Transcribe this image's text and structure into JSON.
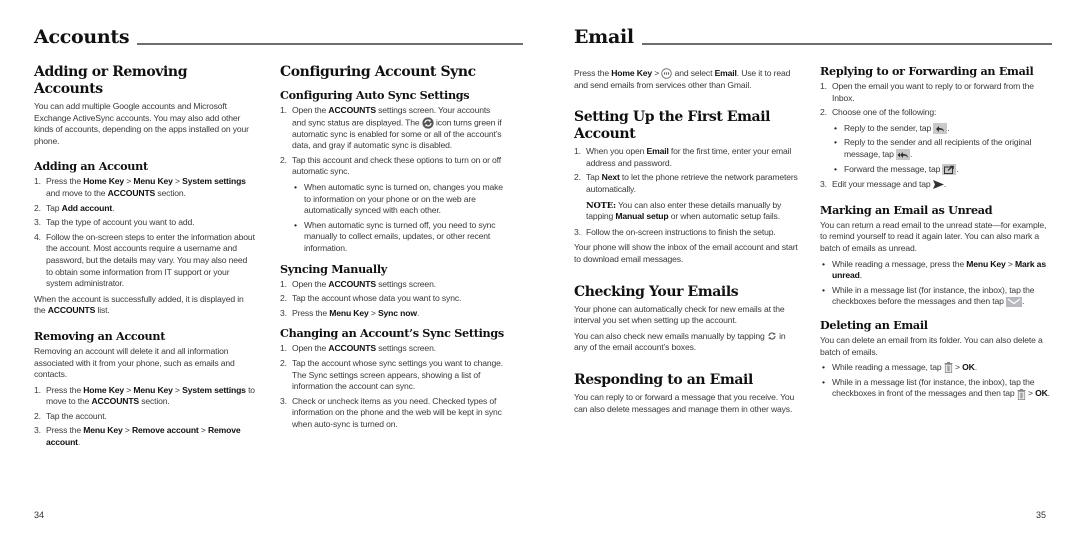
{
  "left_page": {
    "chapter_title": "Accounts",
    "page_number": "34",
    "adding_removing": {
      "title": "Adding or Removing Accounts",
      "intro": "You can add multiple Google accounts and Microsoft Exchange ActiveSync accounts. You may also add other kinds of accounts, depending on the apps installed on your phone.",
      "adding": {
        "title": "Adding an Account",
        "step1": {
          "a": "Press the ",
          "b": "Home Key",
          "c": " > ",
          "d": "Menu Key",
          "e": " > ",
          "f": "System settings",
          "g": " and move to the ",
          "h": "ACCOUNTS",
          "i": " section."
        },
        "step2": {
          "a": "Tap ",
          "b": "Add account",
          "c": "."
        },
        "step3": "Tap the type of account you want to add.",
        "step4": "Follow the on-screen steps to enter the information about the account. Most accounts require a username and password, but the details may vary. You may also need to obtain some information from IT support or your system administrator.",
        "after": {
          "a": "When the account is successfully added, it is displayed in the ",
          "b": "ACCOUNTS",
          "c": " list."
        }
      },
      "removing": {
        "title": "Removing an Account",
        "intro": "Removing an account will delete it and all information associated with it from your phone, such as emails and contacts.",
        "step1": {
          "a": "Press the ",
          "b": "Home Key",
          "c": " > ",
          "d": "Menu Key",
          "e": " > ",
          "f": "System settings",
          "g": " to move to the ",
          "h": "ACCOUNTS",
          "i": " section."
        },
        "step2": "Tap the account.",
        "step3": {
          "a": "Press the ",
          "b": "Menu Key",
          "c": " > ",
          "d": "Remove account",
          "e": " > ",
          "f": "Remove account",
          "g": "."
        }
      }
    },
    "configuring_sync": {
      "title": "Configuring Account Sync",
      "auto": {
        "title": "Configuring Auto Sync Settings",
        "step1": {
          "a": "Open the ",
          "b": "ACCOUNTS",
          "c": " settings screen. Your accounts and sync status are displayed. The ",
          "icon": "sync-status-icon",
          "d": " icon turns green if automatic sync is enabled for some or all of the account’s data, and gray if automatic sync is disabled."
        },
        "step2": "Tap this account and check these options to turn on or off automatic sync.",
        "bullets": [
          "When automatic sync is turned on, changes you make to information on your phone or on the web are automatically synced with each other.",
          "When automatic sync is turned off, you need to sync manually to collect emails, updates, or other recent information."
        ]
      },
      "manual": {
        "title": "Syncing Manually",
        "step1": {
          "a": "Open the ",
          "b": "ACCOUNTS",
          "c": " settings screen."
        },
        "step2": "Tap the account whose data you want to sync.",
        "step3": {
          "a": "Press the ",
          "b": "Menu Key",
          "c": " > ",
          "d": "Sync now",
          "e": "."
        }
      },
      "changing": {
        "title": "Changing an Account’s Sync Settings",
        "step1": {
          "a": "Open the ",
          "b": "ACCOUNTS",
          "c": " settings screen."
        },
        "step2": "Tap the account whose sync settings you want to change. The Sync settings screen appears, showing a list of information the account can sync.",
        "step3": "Check or uncheck items as you need. Checked types of information on the phone and the web will be kept in sync when auto-sync is turned on."
      }
    }
  },
  "right_page": {
    "chapter_title": "Email",
    "page_number": "35",
    "intro": {
      "a": "Press the ",
      "b": "Home Key",
      "c": " > ",
      "icon": "apps-icon",
      "d": " and select ",
      "e": "Email",
      "f": ". Use it to read and send emails from services other than Gmail."
    },
    "setup": {
      "title": "Setting Up the First Email Account",
      "step1": {
        "a": "When you open ",
        "b": "Email",
        "c": " for the first time, enter your email address and password."
      },
      "step2": {
        "a": "Tap ",
        "b": "Next",
        "c": " to let the phone retrieve the network parameters automatically."
      },
      "note": {
        "label": "NOTE:",
        "a": " You can also enter these details manually by tapping ",
        "b": "Manual setup",
        "c": " or when automatic setup fails."
      },
      "step3": "Follow the on-screen instructions to finish the setup.",
      "after": "Your phone will show the inbox of the email account and start to download email messages."
    },
    "checking": {
      "title": "Checking Your Emails",
      "p1": "Your phone can automatically check for new emails at the interval you set when setting up the account.",
      "p2": {
        "a": "You can also check new emails manually by tapping ",
        "icon": "refresh-icon",
        "b": " in any of the email account’s boxes."
      }
    },
    "responding": {
      "title": "Responding to an Email",
      "p1": "You can reply to or forward a message that you receive. You can also delete messages and manage them in other ways."
    },
    "replying": {
      "title": "Replying to or Forwarding an Email",
      "step1": "Open the email you want to reply to or forward from the Inbox.",
      "step2": "Choose one of the following:",
      "bullets": [
        {
          "text": "Reply to the sender, tap ",
          "icon": "reply-icon",
          "end": "."
        },
        {
          "text": "Reply to the sender and all recipients of the original message, tap ",
          "icon": "reply-all-icon",
          "end": "."
        },
        {
          "text": "Forward the message, tap ",
          "icon": "forward-icon",
          "end": "."
        }
      ],
      "step3": {
        "a": "Edit your message and tap ",
        "icon": "send-icon",
        "b": "."
      }
    },
    "unread": {
      "title": "Marking an Email as Unread",
      "p1": "You can return a read email to the unread state—for example, to remind yourself to read it again later. You can also mark a batch of emails as unread.",
      "bullet1": {
        "a": "While reading a message, press the ",
        "b": "Menu Key",
        "c": " > ",
        "d": "Mark as unread",
        "e": "."
      },
      "bullet2": {
        "a": "While in a message list (for instance, the inbox), tap the checkboxes before the messages and then tap ",
        "icon": "mark-unread-icon",
        "b": "."
      }
    },
    "deleting": {
      "title": "Deleting an Email",
      "p1": "You can delete an email from its folder. You can also delete a batch of emails.",
      "bullet1": {
        "a": "While reading a message, tap ",
        "icon": "trash-icon",
        "b": " > ",
        "c": "OK",
        "d": "."
      },
      "bullet2": {
        "a": "While in a message list (for instance, the inbox), tap the checkboxes in front of the messages and then tap ",
        "icon": "trash-icon",
        "b": " > ",
        "c": "OK",
        "d": "."
      }
    }
  }
}
